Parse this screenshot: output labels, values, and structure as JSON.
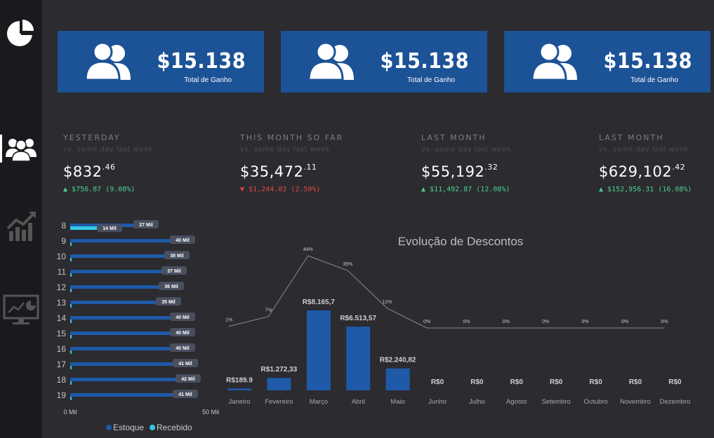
{
  "kpis": [
    {
      "value": "$15.138",
      "caption": "Total de Ganho",
      "icon": "users-icon"
    },
    {
      "value": "$15.138",
      "caption": "Total de Ganho",
      "icon": "users-icon"
    },
    {
      "value": "$15.138",
      "caption": "Total de Ganho",
      "icon": "users-icon"
    }
  ],
  "stats": [
    {
      "title": "YESTERDAY",
      "subtitle": "vs. same day last week",
      "main": "$832",
      "cents": ".46",
      "change": "$756.87 (9.08%)",
      "direction": "up"
    },
    {
      "title": "THIS MONTH SO FAR",
      "subtitle": "vs. same day last week",
      "main": "$35,472",
      "cents": ".11",
      "change": "$1,244.02 (2.50%)",
      "direction": "down"
    },
    {
      "title": "LAST MONTH",
      "subtitle": "vs. same day last week",
      "main": "$55,192",
      "cents": ".32",
      "change": "$11,492.87 (12.08%)",
      "direction": "up"
    },
    {
      "title": "LAST MONTH",
      "subtitle": "vs. same day last week",
      "main": "$629,102",
      "cents": ".42",
      "change": "$152,956.31 (16.08%)",
      "direction": "up"
    }
  ],
  "sidebar": {
    "icons": [
      "pie-chart-icon",
      "users-group-icon",
      "trending-up-icon",
      "dashboard-monitor-icon"
    ]
  },
  "colors": {
    "kpi_bg": "#1c5296",
    "bar_blue": "#1e5aa8",
    "bar_cyan": "#35c8e6",
    "up": "#4ed28c",
    "down": "#e64646"
  },
  "chart_data": [
    {
      "type": "bar",
      "orientation": "horizontal",
      "categories": [
        "8",
        "9",
        "10",
        "11",
        "12",
        "13",
        "14",
        "15",
        "16",
        "17",
        "18",
        "19"
      ],
      "series": [
        {
          "name": "Estoque",
          "values": [
            27,
            40,
            38,
            37,
            36,
            35,
            40,
            40,
            40,
            41,
            42,
            41
          ]
        },
        {
          "name": "Recebido",
          "values": [
            14,
            0,
            0,
            0,
            0,
            0,
            0,
            0,
            0,
            0,
            0,
            0
          ]
        }
      ],
      "data_labels": [
        "27 Mil",
        "40 Mil",
        "38 Mil",
        "37 Mil",
        "36 Mil",
        "35 Mil",
        "40 Mil",
        "40 Mil",
        "40 Mil",
        "41 Mil",
        "42 Mil",
        "41 Mil"
      ],
      "secondary_labels": [
        "14 Mil"
      ],
      "xlim": [
        0,
        50
      ],
      "xticks": [
        "0 Mil",
        "50 Mil"
      ],
      "legend": "bottom"
    },
    {
      "type": "bar",
      "title": "Evolução de Descontos",
      "categories": [
        "Janeiro",
        "Fevereiro",
        "Março",
        "Abril",
        "Maio",
        "Junho",
        "Julho",
        "Agosto",
        "Setembro",
        "Outubro",
        "Novembro",
        "Dezembro"
      ],
      "values": [
        189.9,
        1272.33,
        8165.7,
        6513.57,
        2240.82,
        0,
        0,
        0,
        0,
        0,
        0,
        0
      ],
      "value_labels": [
        "R$189.9",
        "R$1.272,33",
        "R$8.165,7",
        "R$6.513,57",
        "R$2.240,82",
        "R$0",
        "R$0",
        "R$0",
        "R$0",
        "R$0",
        "R$0",
        "R$0"
      ],
      "line": {
        "values": [
          1,
          7,
          44,
          35,
          12,
          0,
          0,
          0,
          0,
          0,
          0,
          0
        ],
        "labels": [
          "1%",
          "7%",
          "44%",
          "35%",
          "12%",
          "0%",
          "0%",
          "0%",
          "0%",
          "0%",
          "0%",
          "0%"
        ]
      }
    }
  ]
}
